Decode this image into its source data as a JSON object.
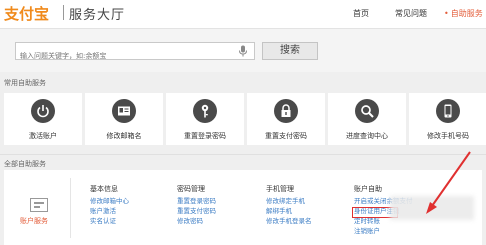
{
  "header": {
    "logo_text": "支付宝",
    "title": "服务大厅",
    "nav": {
      "home": "首页",
      "faq": "常见问题",
      "self_service": "自助服务"
    }
  },
  "search": {
    "placeholder": "输入问题关键字，如:余额宝",
    "button_label": "搜索"
  },
  "common": {
    "section_title": "常用自助服务",
    "tiles": [
      {
        "label": "激活账户",
        "icon": "power-icon"
      },
      {
        "label": "修改邮箱名",
        "icon": "id-card-icon"
      },
      {
        "label": "重置登录密码",
        "icon": "key-icon"
      },
      {
        "label": "重置支付密码",
        "icon": "lock-icon"
      },
      {
        "label": "进度查询中心",
        "icon": "search-icon"
      },
      {
        "label": "修改手机号码",
        "icon": "phone-icon"
      }
    ]
  },
  "all": {
    "section_title": "全部自助服务",
    "account_label": "账户服务",
    "columns": [
      {
        "head": "基本信息",
        "links": [
          "修改邮箱中心",
          "账户激活",
          "实名认证"
        ]
      },
      {
        "head": "密码管理",
        "links": [
          "重置登录密码",
          "重置支付密码",
          "修改密码"
        ]
      },
      {
        "head": "手机管理",
        "links": [
          "修改绑定手机",
          "解绑手机",
          "修改手机登录名"
        ]
      },
      {
        "head": "账户自助",
        "links": [
          "开启或关闭余额支付",
          "身份证用户注销",
          "定时转账",
          "注销账户"
        ]
      }
    ]
  },
  "colors": {
    "accent": "#e35d3a",
    "link": "#3b7cc4",
    "highlight": "#e03030",
    "icon_bg": "#4a4a4a"
  }
}
